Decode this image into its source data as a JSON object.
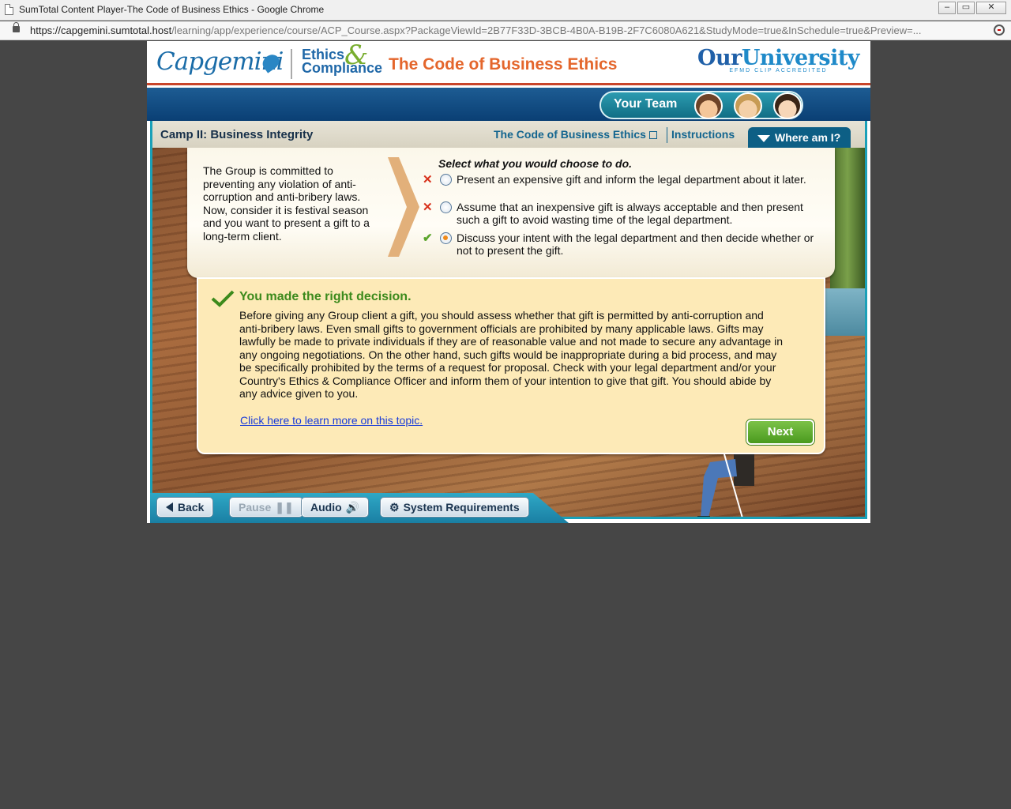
{
  "window": {
    "title": "SumTotal Content Player-The Code of Business Ethics - Google Chrome",
    "url_host": "https://capgemini.sumtotal.host",
    "url_path": "/learning/app/experience/course/ACP_Course.aspx?PackageViewId=2B77F33D-3BCB-4B0A-B19B-2F7C6080A621&StudyMode=true&InSchedule=true&Preview=...",
    "controls": {
      "minimize": "–",
      "restore": "▭",
      "close": "✕"
    }
  },
  "header": {
    "brand": "Capgemini",
    "ethics_line1": "Ethics",
    "ethics_line2": "Compliance",
    "ethics_amp": "&",
    "course_title": "The Code of Business Ethics",
    "university_prefix": "Our",
    "university_name": "University",
    "university_sub": "EFMD CLIP ACCREDITED"
  },
  "team": {
    "label": "Your Team"
  },
  "nav": {
    "camp": "Camp II: Business Integrity",
    "code_link": "The Code of Business Ethics",
    "instructions": "Instructions",
    "where_am_i": "Where am I?"
  },
  "question": {
    "scenario": "The Group is committed to preventing any violation of anti-corruption and anti-bribery laws. Now, consider it is festival season and you want to present a gift to a long-term client.",
    "prompt": "Select what you would choose to do.",
    "options": [
      {
        "text": "Present an expensive gift and inform the legal department  about it later.",
        "mark": "✕",
        "selected": false
      },
      {
        "text": "Assume that an inexpensive gift is always acceptable and then present such a gift to avoid wasting time of the legal department.",
        "mark": "✕",
        "selected": false
      },
      {
        "text": "Discuss your intent with the legal department and then decide whether or not to present the gift.",
        "mark": "✔",
        "selected": true
      }
    ]
  },
  "feedback": {
    "title": "You made the right decision.",
    "body": "Before giving any Group client a gift, you should assess whether that gift is permitted by anti-corruption and anti-bribery laws. Even small gifts to government officials are prohibited by many applicable laws. Gifts may lawfully be made to private individuals if they are of reasonable value and not made to secure any advantage in any ongoing negotiations. On the other hand, such gifts would be inappropriate during a bid process, and may be specifically prohibited by the terms of a request for proposal. Check with your legal department and/or your Country's Ethics & Compliance Officer and inform them of your intention to give that gift. You should abide by any advice given to you.",
    "link": "Click here to learn more on this topic.",
    "next": "Next"
  },
  "footer": {
    "back": "Back",
    "pause": "Pause",
    "audio": "Audio",
    "system_requirements": "System Requirements"
  },
  "colors": {
    "accent_orange": "#e4662c",
    "header_blue": "#0a3f74",
    "teal_frame": "#1aa0b8",
    "feedback_bg": "#fdeab7",
    "correct_green": "#3c8a1c",
    "wrong_red": "#d8321c"
  }
}
